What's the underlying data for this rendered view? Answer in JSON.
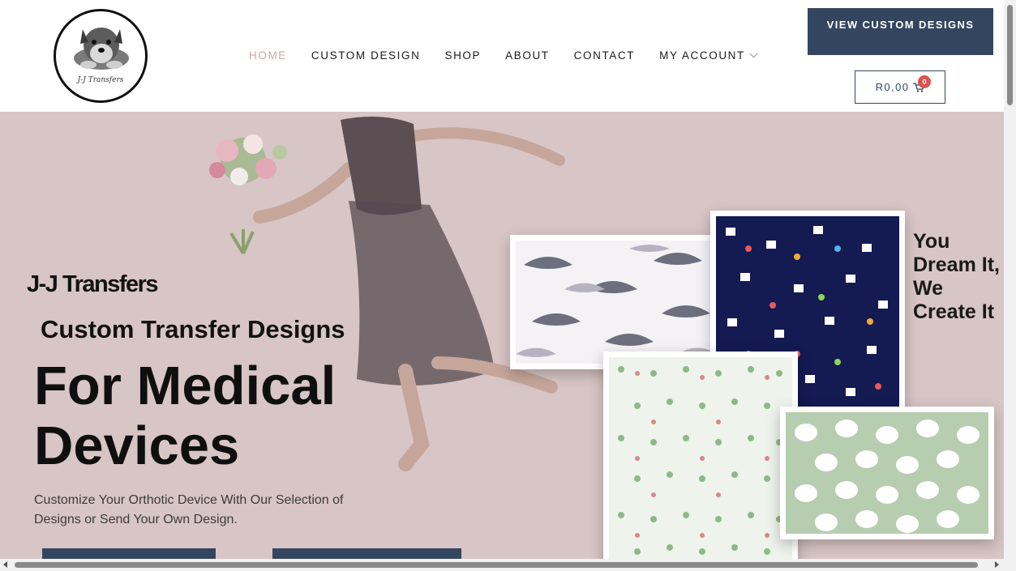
{
  "logo": {
    "text": "J-J Transfers",
    "icon": "schnauzer-dog-logo"
  },
  "nav": {
    "items": [
      "HOME",
      "CUSTOM DESIGN",
      "SHOP",
      "ABOUT",
      "CONTACT",
      "MY ACCOUNT"
    ],
    "active": "HOME"
  },
  "header": {
    "cta_label": "VIEW CUSTOM DESIGNS",
    "cart_price": "R0,00",
    "cart_count": "0"
  },
  "hero": {
    "brand": "J-J Transfers",
    "subtitle": "Custom Transfer Designs",
    "headline_line1": "For Medical",
    "headline_line2": "Devices",
    "description": "Customize Your Orthotic Device With Our Selection of Designs or Send Your Own Design.",
    "tagline": "You Dream It, We Create It",
    "background_color": "#d8c5c5"
  },
  "colors": {
    "accent": "#34465f",
    "nav_active": "#c7a9a6",
    "badge": "#d9534f"
  }
}
